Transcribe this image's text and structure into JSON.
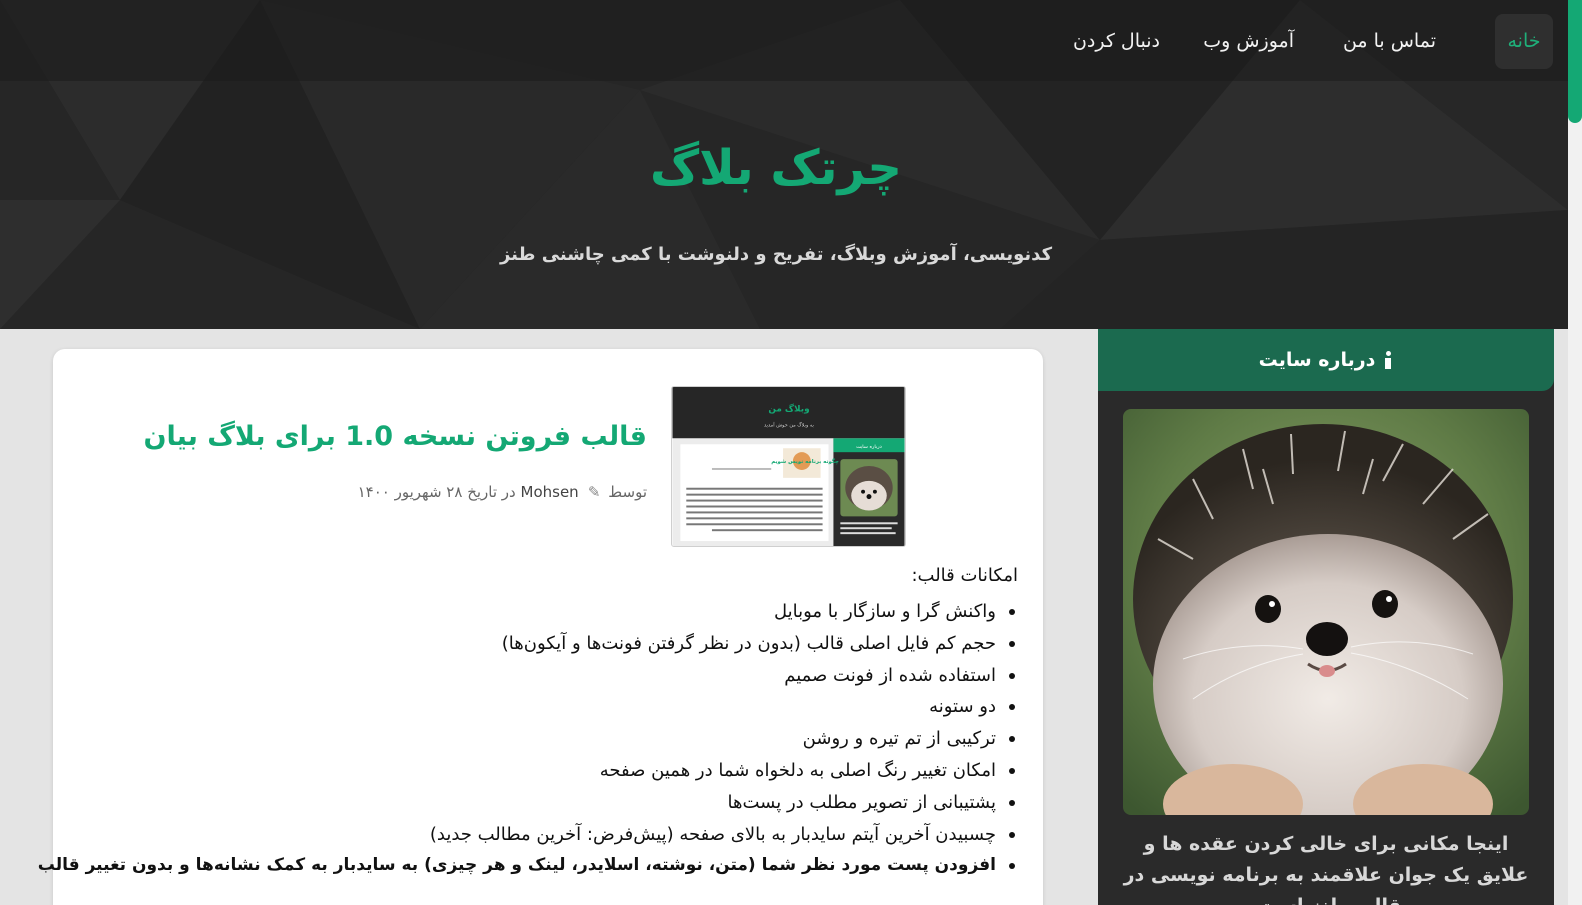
{
  "nav": {
    "items": [
      {
        "label": "خانه",
        "active": true
      },
      {
        "label": "تماس با من",
        "active": false
      },
      {
        "label": "آموزش وب",
        "active": false
      },
      {
        "label": "دنبال کردن",
        "active": false
      }
    ]
  },
  "site": {
    "title": "چرتک بلاگ",
    "tagline": "کدنویسی، آموزش وبلاگ، تفریح و دلنوشت با کمی چاشنی طنز"
  },
  "post": {
    "title": "قالب فروتن نسخه 1.0 برای بلاگ بیان",
    "meta": {
      "by": "توسط",
      "author": "Mohsen",
      "date": "در تاریخ ۲۸ شهریور ۱۴۰۰"
    },
    "thumbnail": {
      "blog_title": "وبلاگ من",
      "blog_subtitle": "به وبلاگ من خوش آمدید",
      "sidebar_head": "درباره سایت",
      "post_title": "چگونه برنامه نویس شویم"
    },
    "features_title": "امکانات قالب:",
    "features": [
      "واکنش گرا و سازگار با موبایل",
      "حجم کم فایل اصلی قالب (بدون در نظر گرفتن فونت‌ها و آیکون‌ها)",
      "استفاده شده از فونت صمیم",
      "دو ستونه",
      "ترکیبی از تم تیره و روشن",
      "امکان تغییر رنگ اصلی به دلخواه شما در همین صفحه",
      "پشتیبانی از تصویر مطلب در پست‌ها",
      "چسبیدن آخرین آیتم سایدبار به بالای صفحه (پیش‌فرض: آخرین مطالب جدید)",
      "افزودن پست مورد نظر شما (متن، نوشته، اسلایدر، لینک و هر چیزی) به سایدبار به کمک نشانه‌ها و بدون تغییر قالب"
    ]
  },
  "sidebar": {
    "widget_title": "درباره سایت",
    "about_text": "اینجا مکانی برای خالی کردن عقده ها و علایق یک جوان علاقمند به برنامه نویسی در قالب طنز است."
  },
  "icons": {
    "widget_title": "info-icon",
    "meta": "pen-icon"
  },
  "colors": {
    "accent": "#14a874",
    "header_bg": "#262626",
    "sidebar_head": "#1b6a4f"
  }
}
